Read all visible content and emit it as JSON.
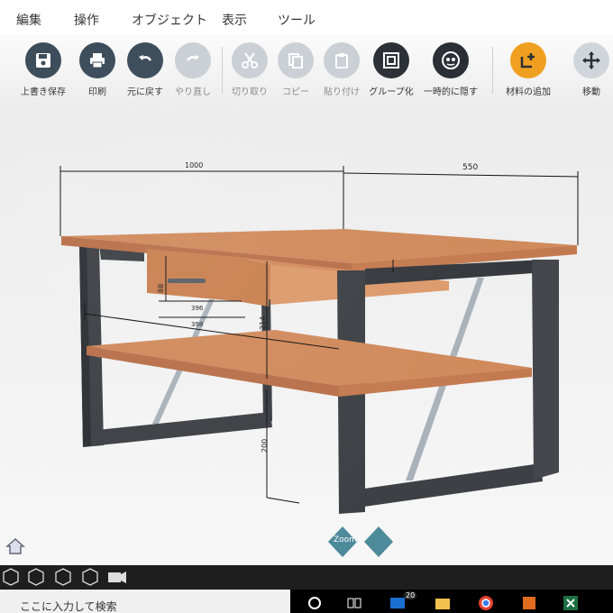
{
  "menu": {
    "items": [
      "編集",
      "操作",
      "オブジェクト",
      "表示",
      "ツール"
    ]
  },
  "toolbar": {
    "buttons": [
      {
        "label": "上書き保存",
        "icon": "save-icon",
        "enabled": true
      },
      {
        "label": "印刷",
        "icon": "print-icon",
        "enabled": true
      },
      {
        "label": "元に戻す",
        "icon": "undo-icon",
        "enabled": true
      },
      {
        "label": "やり直し",
        "icon": "redo-icon",
        "enabled": false
      },
      {
        "label": "切り取り",
        "icon": "cut-icon",
        "enabled": false
      },
      {
        "label": "コピー",
        "icon": "copy-icon",
        "enabled": false
      },
      {
        "label": "貼り付け",
        "icon": "paste-icon",
        "enabled": false
      },
      {
        "label": "グループ化",
        "icon": "group-icon",
        "enabled": true
      },
      {
        "label": "一時的に隠す",
        "icon": "hide-icon",
        "enabled": true
      },
      {
        "label": "材料の追加",
        "icon": "add-material-icon",
        "enabled": true
      },
      {
        "label": "移動",
        "icon": "move-icon",
        "enabled": true
      }
    ]
  },
  "model": {
    "dimensions": {
      "width": "1000",
      "depth": "550",
      "drawer_height": "88",
      "drawer_inner": "396",
      "drawer_width": "398",
      "shelf_gap": "214",
      "shelf_height": "200"
    }
  },
  "nav": {
    "zoom_label": "Zoom"
  },
  "taskbar": {
    "search_placeholder": "ここに入力して検索",
    "mail_badge": "20"
  },
  "colors": {
    "toolbar_icon": "#3a4a58",
    "toolbar_icon_disabled": "#c9cfd4",
    "accent": "#f0a020",
    "wood": "#d08a5c",
    "frame": "#3d4044"
  }
}
